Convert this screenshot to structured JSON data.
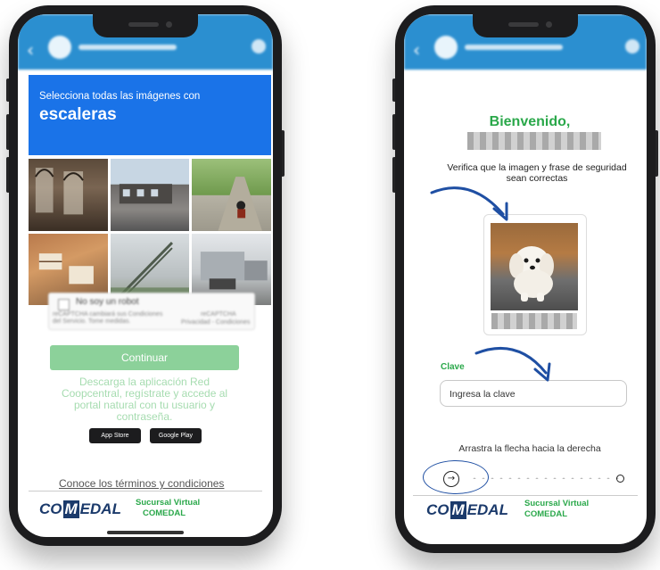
{
  "left_phone": {
    "captcha": {
      "instruction": "Selecciona todas las imágenes con",
      "keyword": "escaleras",
      "checkbox_label": "No soy un robot",
      "recaptcha_note": "reCAPTCHA cambiará sus Condiciones del Servicio. Tome medidas.",
      "recaptcha_brand": "reCAPTCHA",
      "recaptcha_links": "Privacidad - Condiciones"
    },
    "continue_button": "Continuar",
    "promo_text": "Descarga la aplicación Red Coopcentral, regístrate y accede al portal natural con tu usuario y contraseña.",
    "store_buttons": [
      "App Store",
      "Google Play"
    ],
    "terms_link": "Conoce los términos y condiciones",
    "footer": {
      "logo": "COMEDAL",
      "tagline_1": "Sucursal Virtual",
      "tagline_2": "COMEDAL"
    }
  },
  "right_phone": {
    "welcome": "Bienvenido,",
    "verify_text": "Verifica que la imagen y frase de seguridad sean correctas",
    "clave_label": "Clave",
    "clave_placeholder": "Ingresa la clave",
    "drag_instruction": "Arrastra la flecha hacia la derecha",
    "footer": {
      "logo": "COMEDAL",
      "tagline_1": "Sucursal Virtual",
      "tagline_2": "COMEDAL"
    }
  },
  "colors": {
    "brand_blue": "#2b8fd0",
    "captcha_blue": "#1a73e8",
    "green": "#2aa84a",
    "annotation_blue": "#1f4fa3"
  },
  "icons": [
    "back-arrow-icon",
    "arrow-right-icon",
    "pointer-arrow-icon"
  ]
}
